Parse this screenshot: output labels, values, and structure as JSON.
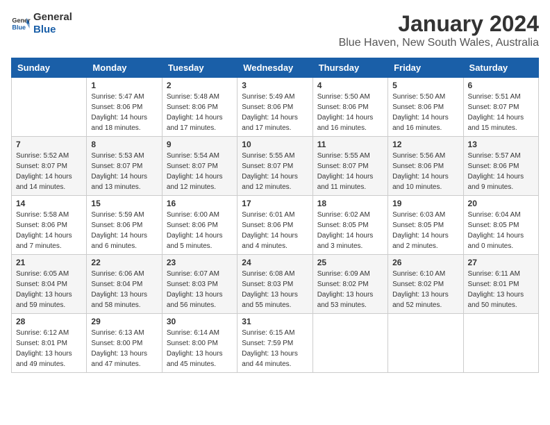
{
  "header": {
    "logo_line1": "General",
    "logo_line2": "Blue",
    "title": "January 2024",
    "subtitle": "Blue Haven, New South Wales, Australia"
  },
  "days_of_week": [
    "Sunday",
    "Monday",
    "Tuesday",
    "Wednesday",
    "Thursday",
    "Friday",
    "Saturday"
  ],
  "weeks": [
    [
      {
        "day": "",
        "info": ""
      },
      {
        "day": "1",
        "info": "Sunrise: 5:47 AM\nSunset: 8:06 PM\nDaylight: 14 hours\nand 18 minutes."
      },
      {
        "day": "2",
        "info": "Sunrise: 5:48 AM\nSunset: 8:06 PM\nDaylight: 14 hours\nand 17 minutes."
      },
      {
        "day": "3",
        "info": "Sunrise: 5:49 AM\nSunset: 8:06 PM\nDaylight: 14 hours\nand 17 minutes."
      },
      {
        "day": "4",
        "info": "Sunrise: 5:50 AM\nSunset: 8:06 PM\nDaylight: 14 hours\nand 16 minutes."
      },
      {
        "day": "5",
        "info": "Sunrise: 5:50 AM\nSunset: 8:06 PM\nDaylight: 14 hours\nand 16 minutes."
      },
      {
        "day": "6",
        "info": "Sunrise: 5:51 AM\nSunset: 8:07 PM\nDaylight: 14 hours\nand 15 minutes."
      }
    ],
    [
      {
        "day": "7",
        "info": "Sunrise: 5:52 AM\nSunset: 8:07 PM\nDaylight: 14 hours\nand 14 minutes."
      },
      {
        "day": "8",
        "info": "Sunrise: 5:53 AM\nSunset: 8:07 PM\nDaylight: 14 hours\nand 13 minutes."
      },
      {
        "day": "9",
        "info": "Sunrise: 5:54 AM\nSunset: 8:07 PM\nDaylight: 14 hours\nand 12 minutes."
      },
      {
        "day": "10",
        "info": "Sunrise: 5:55 AM\nSunset: 8:07 PM\nDaylight: 14 hours\nand 12 minutes."
      },
      {
        "day": "11",
        "info": "Sunrise: 5:55 AM\nSunset: 8:07 PM\nDaylight: 14 hours\nand 11 minutes."
      },
      {
        "day": "12",
        "info": "Sunrise: 5:56 AM\nSunset: 8:06 PM\nDaylight: 14 hours\nand 10 minutes."
      },
      {
        "day": "13",
        "info": "Sunrise: 5:57 AM\nSunset: 8:06 PM\nDaylight: 14 hours\nand 9 minutes."
      }
    ],
    [
      {
        "day": "14",
        "info": "Sunrise: 5:58 AM\nSunset: 8:06 PM\nDaylight: 14 hours\nand 7 minutes."
      },
      {
        "day": "15",
        "info": "Sunrise: 5:59 AM\nSunset: 8:06 PM\nDaylight: 14 hours\nand 6 minutes."
      },
      {
        "day": "16",
        "info": "Sunrise: 6:00 AM\nSunset: 8:06 PM\nDaylight: 14 hours\nand 5 minutes."
      },
      {
        "day": "17",
        "info": "Sunrise: 6:01 AM\nSunset: 8:06 PM\nDaylight: 14 hours\nand 4 minutes."
      },
      {
        "day": "18",
        "info": "Sunrise: 6:02 AM\nSunset: 8:05 PM\nDaylight: 14 hours\nand 3 minutes."
      },
      {
        "day": "19",
        "info": "Sunrise: 6:03 AM\nSunset: 8:05 PM\nDaylight: 14 hours\nand 2 minutes."
      },
      {
        "day": "20",
        "info": "Sunrise: 6:04 AM\nSunset: 8:05 PM\nDaylight: 14 hours\nand 0 minutes."
      }
    ],
    [
      {
        "day": "21",
        "info": "Sunrise: 6:05 AM\nSunset: 8:04 PM\nDaylight: 13 hours\nand 59 minutes."
      },
      {
        "day": "22",
        "info": "Sunrise: 6:06 AM\nSunset: 8:04 PM\nDaylight: 13 hours\nand 58 minutes."
      },
      {
        "day": "23",
        "info": "Sunrise: 6:07 AM\nSunset: 8:03 PM\nDaylight: 13 hours\nand 56 minutes."
      },
      {
        "day": "24",
        "info": "Sunrise: 6:08 AM\nSunset: 8:03 PM\nDaylight: 13 hours\nand 55 minutes."
      },
      {
        "day": "25",
        "info": "Sunrise: 6:09 AM\nSunset: 8:02 PM\nDaylight: 13 hours\nand 53 minutes."
      },
      {
        "day": "26",
        "info": "Sunrise: 6:10 AM\nSunset: 8:02 PM\nDaylight: 13 hours\nand 52 minutes."
      },
      {
        "day": "27",
        "info": "Sunrise: 6:11 AM\nSunset: 8:01 PM\nDaylight: 13 hours\nand 50 minutes."
      }
    ],
    [
      {
        "day": "28",
        "info": "Sunrise: 6:12 AM\nSunset: 8:01 PM\nDaylight: 13 hours\nand 49 minutes."
      },
      {
        "day": "29",
        "info": "Sunrise: 6:13 AM\nSunset: 8:00 PM\nDaylight: 13 hours\nand 47 minutes."
      },
      {
        "day": "30",
        "info": "Sunrise: 6:14 AM\nSunset: 8:00 PM\nDaylight: 13 hours\nand 45 minutes."
      },
      {
        "day": "31",
        "info": "Sunrise: 6:15 AM\nSunset: 7:59 PM\nDaylight: 13 hours\nand 44 minutes."
      },
      {
        "day": "",
        "info": ""
      },
      {
        "day": "",
        "info": ""
      },
      {
        "day": "",
        "info": ""
      }
    ]
  ]
}
